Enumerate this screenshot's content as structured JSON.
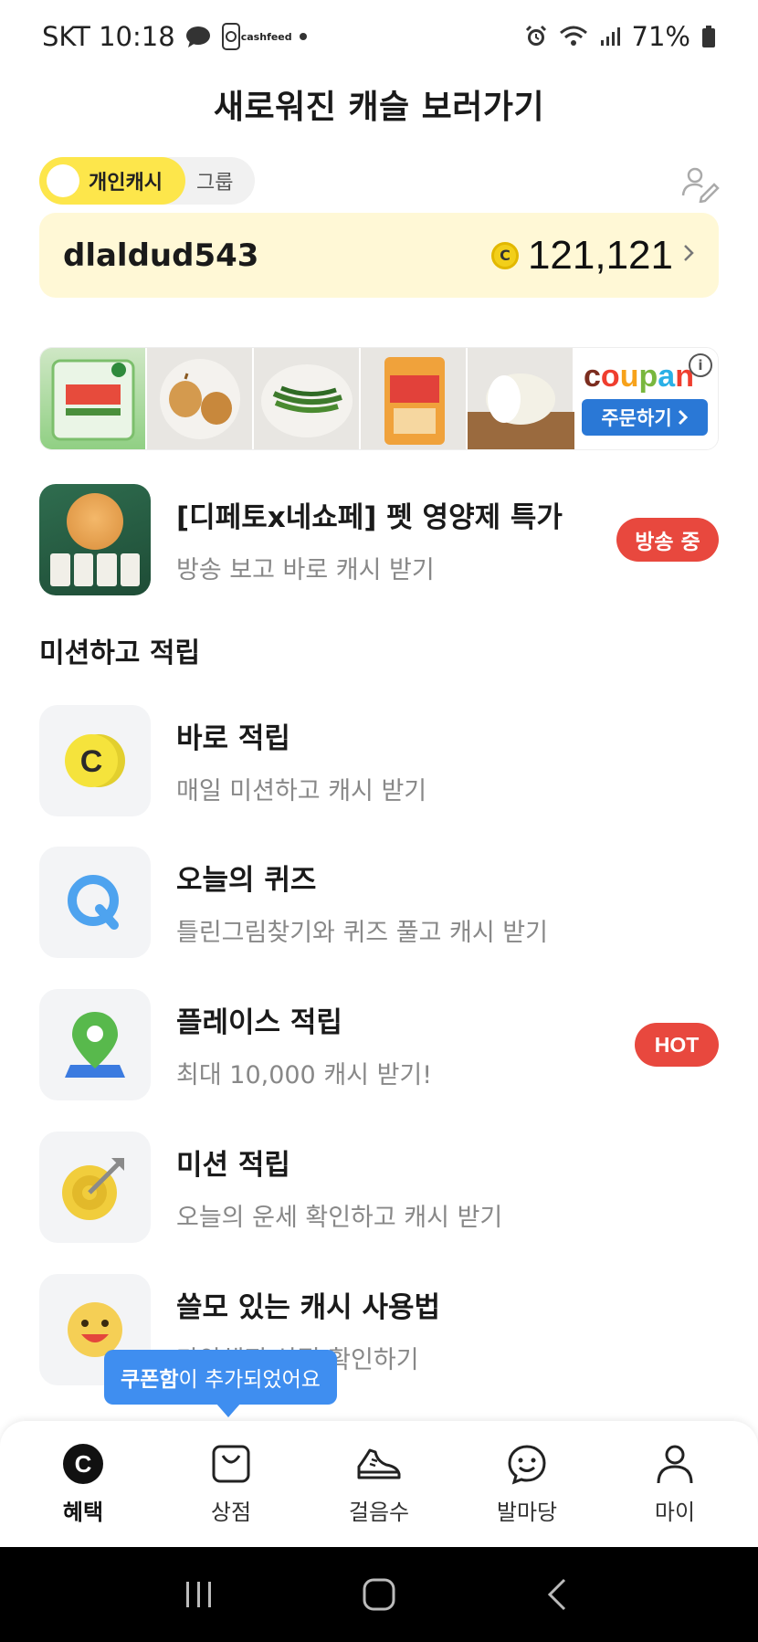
{
  "status_bar": {
    "carrier_time": "SKT 10:18",
    "cashfeed_line1": "cash",
    "cashfeed_line2": "feed",
    "battery": "71%"
  },
  "header": {
    "title": "새로워진 캐슬 보러가기"
  },
  "toggle": {
    "active_label": "개인캐시",
    "inactive_label": "그룹"
  },
  "balance": {
    "username": "dlaldud543",
    "coin_symbol": "C",
    "amount": "121,121"
  },
  "ad_banner": {
    "brand": [
      "c",
      "o",
      "u",
      "p",
      "a",
      "n"
    ],
    "order_button": "주문하기",
    "info": "i"
  },
  "live_item": {
    "title": "[디페토x네쇼페] 펫 영양제 특가",
    "subtitle": "방송 보고 바로 캐시 받기",
    "badge": "방송 중"
  },
  "section": {
    "title": "미션하고 적립"
  },
  "missions": [
    {
      "title": "바로 적립",
      "subtitle": "매일 미션하고 캐시 받기",
      "icon": "coin-c-icon"
    },
    {
      "title": "오늘의 퀴즈",
      "subtitle": "틀린그림찾기와 퀴즈 풀고 캐시 받기",
      "icon": "quiz-q-icon"
    },
    {
      "title": "플레이스 적립",
      "subtitle": "최대 10,000 캐시 받기!",
      "icon": "map-pin-icon",
      "badge": "HOT"
    },
    {
      "title": "미션 적립",
      "subtitle": "오늘의 운세 확인하고 캐시 받기",
      "icon": "target-icon"
    },
    {
      "title": "쓸모 있는 캐시 사용법",
      "subtitle": "다양해진 상점 확인하기",
      "icon": "smiley-icon"
    }
  ],
  "tooltip": {
    "bold": "쿠폰함",
    "rest": "이 추가되었어요"
  },
  "bottom_nav": [
    {
      "label": "혜택",
      "icon": "benefit-c-icon",
      "active": true
    },
    {
      "label": "상점",
      "icon": "shopping-bag-icon"
    },
    {
      "label": "걸음수",
      "icon": "sneaker-icon"
    },
    {
      "label": "발마당",
      "icon": "chat-smile-icon"
    },
    {
      "label": "마이",
      "icon": "person-icon"
    }
  ],
  "colors": {
    "accent_yellow": "#fde64b",
    "balance_bg": "#fff8d6",
    "badge_red": "#e8483e",
    "tooltip_blue": "#3f8ef0"
  }
}
